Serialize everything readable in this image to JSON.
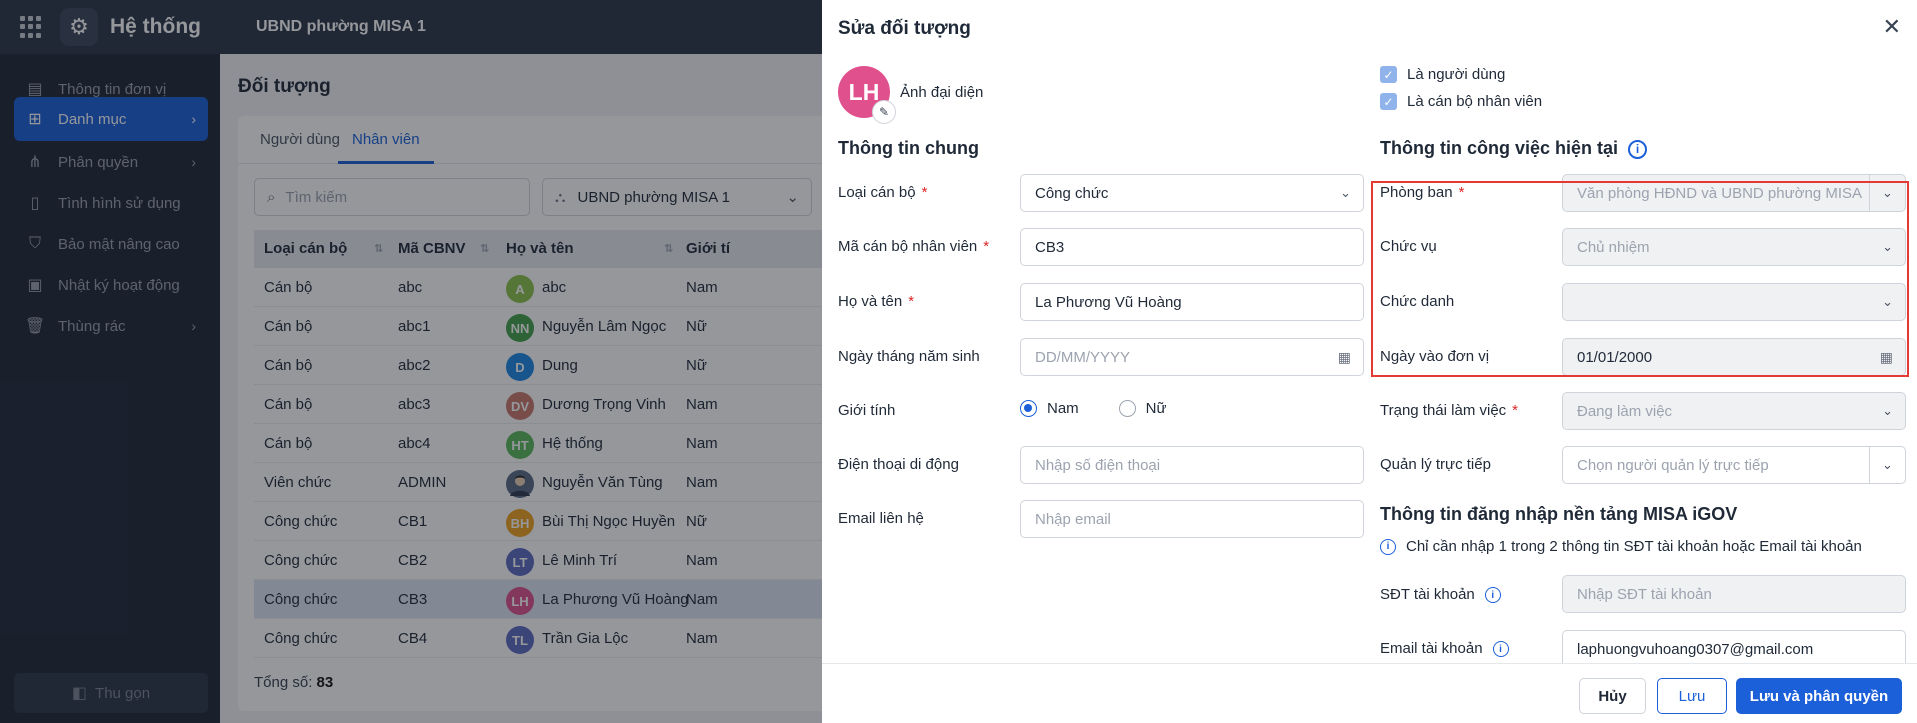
{
  "topbar": {
    "app_title": "Hệ thống",
    "org_name": "UBND phường MISA 1"
  },
  "sidebar": {
    "items": [
      {
        "label": "Thông tin đơn vị",
        "icon": "building-icon"
      },
      {
        "label": "Danh mục",
        "icon": "grid-icon",
        "active": true
      },
      {
        "label": "Phân quyền",
        "icon": "share-icon"
      },
      {
        "label": "Tình hình sử dụng",
        "icon": "document-icon"
      },
      {
        "label": "Bảo mật nâng cao",
        "icon": "shield-icon"
      },
      {
        "label": "Nhật ký hoạt động",
        "icon": "clipboard-icon"
      },
      {
        "label": "Thùng rác",
        "icon": "trash-icon"
      }
    ],
    "collapse_label": "Thu gọn"
  },
  "main": {
    "page_title": "Đối tượng",
    "tabs": [
      {
        "label": "Người dùng"
      },
      {
        "label": "Nhân viên",
        "active": true
      }
    ],
    "search_placeholder": "Tìm kiếm",
    "org_filter": "UBND phường MISA 1",
    "columns": [
      "Loại cán bộ",
      "Mã CBNV",
      "Họ và tên",
      "Giới tí"
    ],
    "rows": [
      {
        "type": "Cán bộ",
        "code": "abc",
        "initials": "A",
        "name": "abc",
        "gender": "Nam",
        "color": "#8bc34a"
      },
      {
        "type": "Cán bộ",
        "code": "abc1",
        "initials": "NN",
        "name": "Nguyễn Lâm Ngọc",
        "gender": "Nữ",
        "color": "#43a047"
      },
      {
        "type": "Cán bộ",
        "code": "abc2",
        "initials": "D",
        "name": "Dung",
        "gender": "Nữ",
        "color": "#1e88e5"
      },
      {
        "type": "Cán bộ",
        "code": "abc3",
        "initials": "DV",
        "name": "Dương Trọng Vinh",
        "gender": "Nam",
        "color": "#c9776a"
      },
      {
        "type": "Cán bộ",
        "code": "abc4",
        "initials": "HT",
        "name": "Hệ thống",
        "gender": "Nam",
        "color": "#5cb85c"
      },
      {
        "type": "Viên chức",
        "code": "ADMIN",
        "initials": "",
        "name": "Nguyễn Văn Tùng",
        "gender": "Nam",
        "color": "#5b6b86"
      },
      {
        "type": "Công chức",
        "code": "CB1",
        "initials": "BH",
        "name": "Bùi Thị Ngọc Huyền",
        "gender": "Nữ",
        "color": "#f0a020"
      },
      {
        "type": "Công chức",
        "code": "CB2",
        "initials": "LT",
        "name": "Lê Minh Trí",
        "gender": "Nam",
        "color": "#5c6bc0"
      },
      {
        "type": "Công chức",
        "code": "CB3",
        "initials": "LH",
        "name": "La Phương Vũ Hoàng",
        "gender": "Nam",
        "color": "#e0508d",
        "selected": true
      },
      {
        "type": "Công chức",
        "code": "CB4",
        "initials": "TL",
        "name": "Trần Gia Lộc",
        "gender": "Nam",
        "color": "#5c6bc0"
      }
    ],
    "total_label": "Tổng số:",
    "total_value": "83"
  },
  "panel": {
    "title": "Sửa đối tượng",
    "avatar_initials": "LH",
    "avatar_label": "Ảnh đại diện",
    "checkbox_user": "Là người dùng",
    "checkbox_staff": "Là cán bộ nhân viên",
    "general_title": "Thông tin chung",
    "fields": {
      "loai_can_bo": {
        "label": "Loại cán bộ",
        "value": "Công chức"
      },
      "ma_cbnv": {
        "label": "Mã cán bộ nhân viên",
        "value": "CB3"
      },
      "ho_ten": {
        "label": "Họ và tên",
        "value": "La Phương Vũ Hoàng"
      },
      "ngay_sinh": {
        "label": "Ngày tháng năm sinh",
        "placeholder": "DD/MM/YYYY"
      },
      "gioi_tinh": {
        "label": "Giới tính",
        "options": [
          "Nam",
          "Nữ"
        ],
        "selected": "Nam"
      },
      "dien_thoai": {
        "label": "Điện thoại di động",
        "placeholder": "Nhập số điện thoại"
      },
      "email": {
        "label": "Email liên hệ",
        "placeholder": "Nhập email"
      }
    },
    "job_title": "Thông tin công việc hiện tại",
    "job": {
      "phong_ban": {
        "label": "Phòng ban",
        "value": "Văn phòng HĐND và UBND phường MISA"
      },
      "chuc_vu": {
        "label": "Chức vụ",
        "value": "Chủ nhiệm"
      },
      "chuc_danh": {
        "label": "Chức danh",
        "value": ""
      },
      "ngay_vao": {
        "label": "Ngày vào đơn vị",
        "value": "01/01/2000"
      },
      "trang_thai": {
        "label": "Trạng thái làm việc",
        "value": "Đang làm việc"
      },
      "quan_ly": {
        "label": "Quản lý trực tiếp",
        "placeholder": "Chọn người quản lý trực tiếp"
      }
    },
    "login_title": "Thông tin đăng nhập nền tảng MISA iGOV",
    "login_note": "Chỉ cần nhập 1 trong 2 thông tin SĐT tài khoản hoặc Email tài khoản",
    "login": {
      "sdt": {
        "label": "SĐT tài khoản",
        "placeholder": "Nhập SĐT tài khoản"
      },
      "email": {
        "label": "Email tài khoản",
        "value": "laphuongvuhoang0307@gmail.com"
      }
    },
    "buttons": {
      "cancel": "Hủy",
      "save": "Lưu",
      "save_perm": "Lưu và phân quyền"
    }
  }
}
